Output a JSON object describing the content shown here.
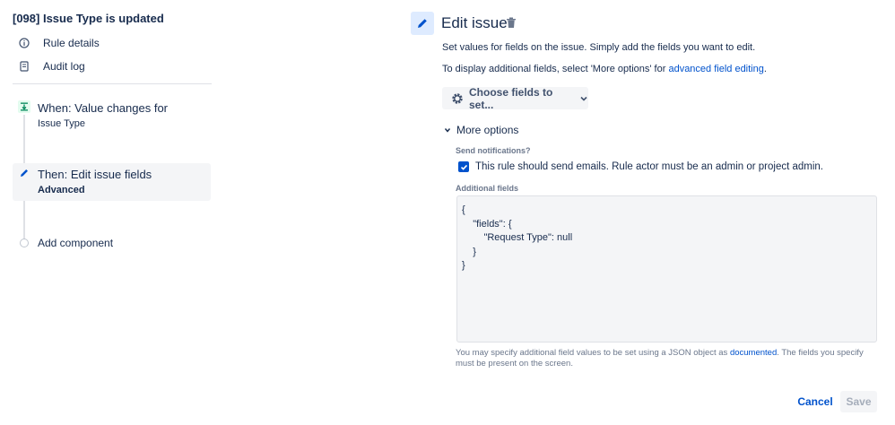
{
  "rule": {
    "title": "[098] Issue Type is updated"
  },
  "nav": [
    {
      "label": "Rule details",
      "icon": "info-icon"
    },
    {
      "label": "Audit log",
      "icon": "document-icon"
    }
  ],
  "steps": {
    "when": {
      "title": "When: Value changes for",
      "subtitle": "Issue Type",
      "icon": "trigger-icon"
    },
    "then": {
      "title": "Then: Edit issue fields",
      "subtitle": "Advanced",
      "icon": "pencil-icon"
    },
    "add_component": "Add component"
  },
  "editor": {
    "heading": "Edit issue",
    "description": "Set values for fields on the issue. Simply add the fields you want to edit.",
    "more_hint_prefix": "To display additional fields, select 'More options' for ",
    "more_hint_link": "advanced field editing",
    "more_hint_suffix": ".",
    "choose_fields_label": "Choose fields to set...",
    "more_options_label": "More options",
    "send_notifications_label": "Send notifications?",
    "send_notifications_checkbox": "This rule should send emails. Rule actor must be an admin or project admin.",
    "send_notifications_checked": true,
    "additional_fields_label": "Additional fields",
    "additional_fields_value": "{\n    \"fields\": {\n        \"Request Type\": null\n    }\n}",
    "help_prefix": "You may specify additional field values to be set using a JSON object as ",
    "help_link": "documented",
    "help_suffix": ". The fields you specify must be present on the screen."
  },
  "actions": {
    "cancel": "Cancel",
    "save": "Save"
  },
  "colors": {
    "accent": "#0052cc",
    "icon_bg": "#deebff",
    "trigger_green": "#00875a"
  }
}
